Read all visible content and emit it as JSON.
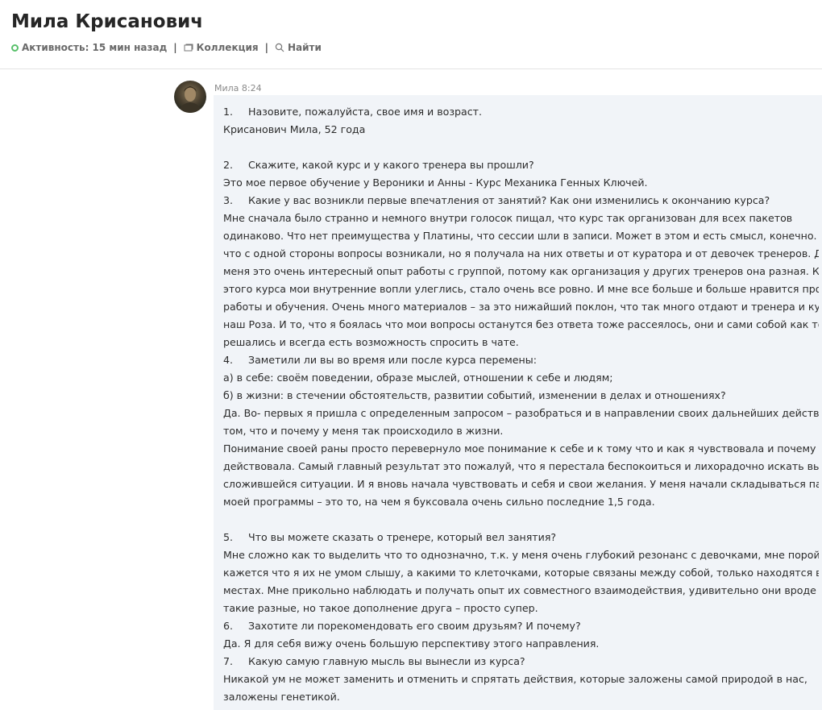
{
  "header": {
    "title": "Мила Крисанович",
    "activity": "Активность: 15 мин назад",
    "separator": "|",
    "collection_label": "Коллекция",
    "search_label": "Найти"
  },
  "message": {
    "author": "Мила 8:24",
    "lines": [
      {
        "num": "1.",
        "text": "Назовите, пожалуйста, свое имя и возраст."
      },
      {
        "text": "Крисанович Мила, 52 года"
      },
      {
        "text": ""
      },
      {
        "num": "2.",
        "text": "Скажите, какой курс и у какого тренера вы прошли?"
      },
      {
        "text": "Это мое первое обучение у Вероники и Анны -  Курс Механика Генных Ключей."
      },
      {
        "num": "3.",
        "text": "Какие у вас возникли первые впечатления от занятий? Как они изменились к окончанию курса?"
      },
      {
        "text": "Мне сначала было странно и немного внутри  голосок пищал, что курс так организован для всех пакетов"
      },
      {
        "text": "одинаково. Что нет преимущества у Платины, что сессии шли в записи. Может в этом и есть смысл, конечно. Потому"
      },
      {
        "text": "что с одной стороны вопросы возникали, но я получала на них ответы и от куратора и от девочек тренеров. Для"
      },
      {
        "text": "меня это очень интересный опыт работы с группой, потому  как организация у других тренеров она разная. К концу"
      },
      {
        "text": "этого курса мои внутренние вопли улеглись, стало очень все ровно. И мне все больше и больше нравится процесс и"
      },
      {
        "text": "работы и обучения. Очень много материалов – за это нижайший поклон, что так много отдают и тренера и куратор"
      },
      {
        "text": "наш Роза. И то, что я боялась  что мои вопросы останутся без ответа тоже рассеялось, они и сами собой как то"
      },
      {
        "text": "решались и всегда есть возможность спросить в чате."
      },
      {
        "num": "4.",
        "text": "Заметили ли вы во время или после курса перемены:"
      },
      {
        "text": "а) в себе: своём поведении, образе мыслей, отношении к себе и людям;"
      },
      {
        "text": "б) в жизни: в стечении обстоятельств, развитии событий, изменении в делах и отношениях?"
      },
      {
        "text": "Да. Во- первых я пришла с определенным запросом – разобраться и в направлении своих дальнейших действий и в"
      },
      {
        "text": "том, что и почему у меня так происходило в жизни."
      },
      {
        "text": "Понимание своей раны просто перевернуло мое понимание к себе и к тому что и как я чувствовала и почему я так"
      },
      {
        "text": "действовала. Самый главный результат это пожалуй, что я перестала беспокоиться и лихорадочно искать выход из"
      },
      {
        "text": "сложившейся ситуации. И я вновь начала чувствовать и себя и свои желания. У меня начали складываться пазлы"
      },
      {
        "text": "моей программы – это то, на чем я буксовала очень сильно последние 1,5 года."
      },
      {
        "text": ""
      },
      {
        "num": "5.",
        "text": "Что вы можете сказать о тренере, который вел занятия?"
      },
      {
        "text": "Мне сложно как то выделить что то однозначно, т.к. у меня очень глубокий резонанс с девочками, мне порой"
      },
      {
        "text": "кажется что я их не умом слышу, а какими то клеточками, которые связаны между собой, только находятся в разных"
      },
      {
        "text": "местах. Мне прикольно наблюдать и получать опыт их совместного взаимодействия, удивительно они вроде бы"
      },
      {
        "text": "такие разные, но такое дополнение друга – просто супер."
      },
      {
        "num": "6.",
        "text": "Захотите ли порекомендовать его своим друзьям? И почему?"
      },
      {
        "text": "Да. Я для себя вижу очень большую перспективу этого направления."
      },
      {
        "num": "7.",
        "text": "Какую самую главную мысль вы вынесли из курса?"
      },
      {
        "text": "Никакой ум не может заменить и отменить и спрятать действия, которые заложены самой природой в нас,"
      },
      {
        "text": "заложены генетикой."
      }
    ]
  }
}
